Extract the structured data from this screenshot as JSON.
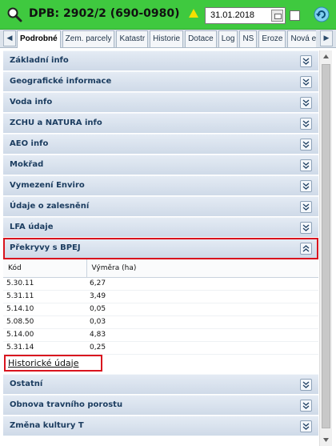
{
  "header": {
    "title": "DPB: 2902/2 (690-0980)",
    "date_value": "31.01.2018",
    "colors": {
      "bar": "#3fc93f",
      "warning": "#f5e000"
    }
  },
  "tabs": [
    "Podrobné",
    "Zem. parcely",
    "Katastr",
    "Historie",
    "Dotace",
    "Log",
    "NS",
    "Eroze",
    "Nová er"
  ],
  "active_tab": "Podrobné",
  "sections_top": [
    "Základní info",
    "Geografické informace",
    "Voda info",
    "ZCHU a NATURA info",
    "AEO info",
    "Mokřad",
    "Vymezení Enviro",
    "Údaje o zalesnění",
    "LFA údaje"
  ],
  "open_section": {
    "label": "Překryvy s BPEJ",
    "columns": [
      "Kód",
      "Výměra (ha)"
    ],
    "rows": [
      [
        "5.30.11",
        "6,27"
      ],
      [
        "5.31.11",
        "3,49"
      ],
      [
        "5.14.10",
        "0,05"
      ],
      [
        "5.08.50",
        "0,03"
      ],
      [
        "5.14.00",
        "4,83"
      ],
      [
        "5.31.14",
        "0,25"
      ]
    ],
    "history_link": "Historické údaje"
  },
  "sections_bottom": [
    "Ostatní",
    "Obnova travního porostu",
    "Změna kultury T"
  ],
  "highlight_color": "#d9141e"
}
